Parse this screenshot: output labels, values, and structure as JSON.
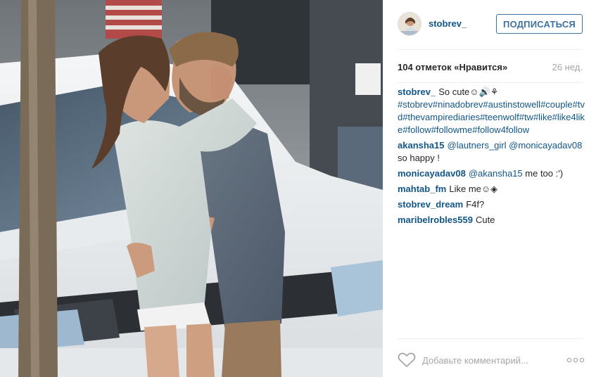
{
  "header": {
    "username": "stobrev_",
    "follow_label": "ПОДПИСАТЬСЯ"
  },
  "stats": {
    "likes": "104 отметок «Нравится»",
    "time": "26 нед."
  },
  "caption": {
    "user": "stobrev_",
    "text": "So cute☺🔊⚘",
    "hashtags": "#stobrev#ninadobrev#austinstowell#couple#tvd#thevampirediaries#teenwolf#tw#like#like4like#follow#followme#follow4follow"
  },
  "comments": [
    {
      "user": "akansha15",
      "mention": "@lautners_girl @monicayadav08",
      "text": " so happy !"
    },
    {
      "user": "monicayadav08",
      "mention": "@akansha15",
      "text": " me too :')"
    },
    {
      "user": "mahtab_fm",
      "mention": "",
      "text": "Like me☺◈"
    },
    {
      "user": "stobrev_dream",
      "mention": "",
      "text": "F4f?"
    },
    {
      "user": "maribelrobles559",
      "mention": "",
      "text": "Cute"
    }
  ],
  "footer": {
    "comment_placeholder": "Добавьте комментарий...",
    "like_icon": "heart-outline-icon",
    "more_icon": "more-options-icon"
  },
  "colors": {
    "username": "#125688",
    "button": "#3f729b",
    "muted": "#a5a7aa"
  }
}
